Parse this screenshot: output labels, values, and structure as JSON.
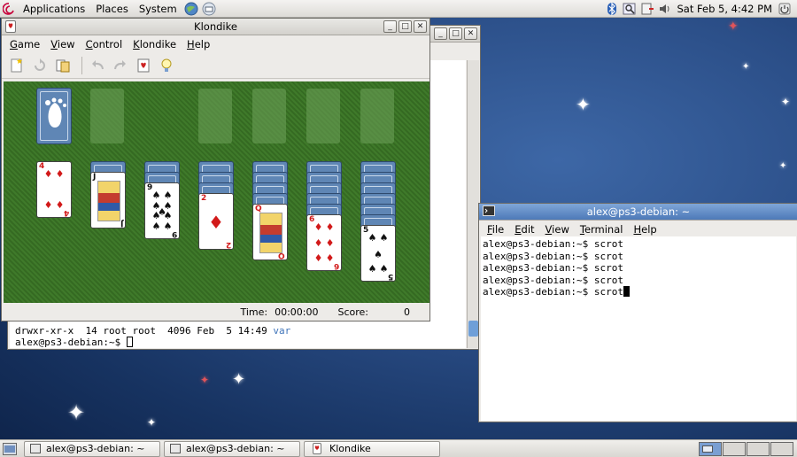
{
  "top_panel": {
    "menus": [
      "Applications",
      "Places",
      "System"
    ],
    "clock": "Sat Feb  5,  4:42 PM"
  },
  "klondike": {
    "title": "Klondike",
    "menus": [
      {
        "label": "Game",
        "key": "G",
        "rest": "ame"
      },
      {
        "label": "View",
        "key": "V",
        "rest": "iew"
      },
      {
        "label": "Control",
        "key": "C",
        "rest": "ontrol"
      },
      {
        "label": "Klondike",
        "key": "K",
        "rest": "londike"
      },
      {
        "label": "Help",
        "key": "H",
        "rest": "elp"
      }
    ],
    "toolbar": [
      "new-game-icon",
      "restart-icon",
      "select-game-icon",
      "undo-icon",
      "redo-icon",
      "deal-icon",
      "hint-icon"
    ],
    "status": {
      "time_label": "Time:",
      "time_value": "00:00:00",
      "score_label": "Score:",
      "score_value": "0"
    },
    "tableau": [
      {
        "hidden": 0,
        "top": {
          "rank": "4",
          "suit": "♦",
          "color": "red"
        }
      },
      {
        "hidden": 1,
        "top": {
          "rank": "J",
          "suit": "♣",
          "color": "blk"
        }
      },
      {
        "hidden": 2,
        "top": {
          "rank": "9",
          "suit": "♠",
          "color": "blk"
        }
      },
      {
        "hidden": 3,
        "top": {
          "rank": "2",
          "suit": "♦",
          "color": "red"
        }
      },
      {
        "hidden": 4,
        "top": {
          "rank": "Q",
          "suit": "♦",
          "color": "red"
        }
      },
      {
        "hidden": 5,
        "top": {
          "rank": "6",
          "suit": "♦",
          "color": "red"
        }
      },
      {
        "hidden": 6,
        "top": {
          "rank": "5",
          "suit": "♠",
          "color": "blk"
        }
      }
    ]
  },
  "term_back": {
    "line_listing": "drwxr-xr-x  14 root root  4096 Feb  5 14:49 ",
    "line_listing_dir": "var",
    "prompt": "alex@ps3-debian:~$ "
  },
  "term_front": {
    "title": "alex@ps3-debian: ~",
    "menus": [
      {
        "key": "F",
        "rest": "ile"
      },
      {
        "key": "E",
        "rest": "dit"
      },
      {
        "key": "V",
        "rest": "iew"
      },
      {
        "key": "T",
        "rest": "erminal"
      },
      {
        "key": "H",
        "rest": "elp"
      }
    ],
    "lines": [
      "alex@ps3-debian:~$ scrot",
      "alex@ps3-debian:~$ scrot",
      "alex@ps3-debian:~$ scrot",
      "alex@ps3-debian:~$ scrot"
    ],
    "last_line": "alex@ps3-debian:~$ scrot"
  },
  "taskbar": {
    "items": [
      "alex@ps3-debian: ~",
      "alex@ps3-debian: ~",
      "Klondike"
    ]
  },
  "colors": {
    "accent": "#4d79b8",
    "felt": "#3f7a2a",
    "card_back": "#5f86b5",
    "ls_dir": "#3f74b9"
  }
}
